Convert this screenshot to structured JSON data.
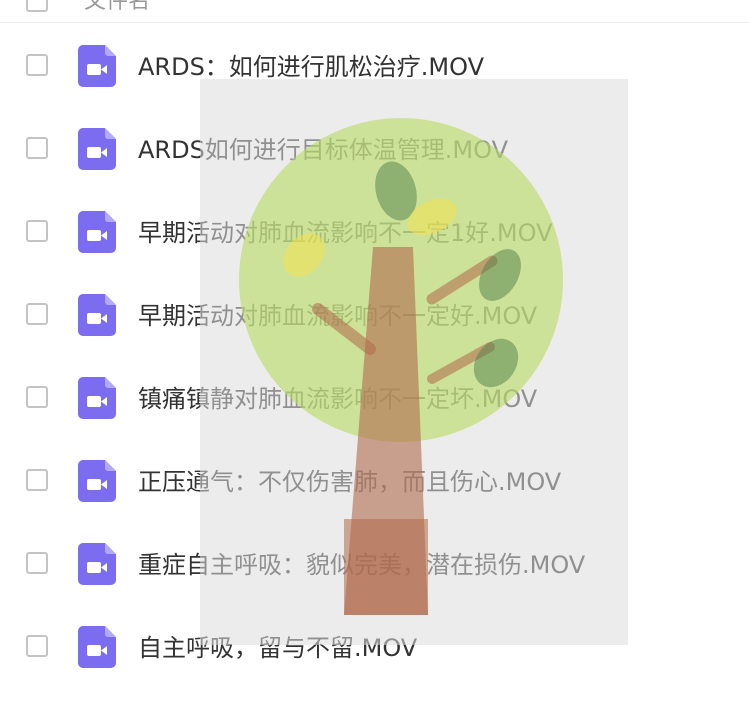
{
  "header": {
    "label": "文件名"
  },
  "files": [
    {
      "name": "ARDS：如何进行肌松治疗.MOV",
      "icon": "video-file-icon"
    },
    {
      "name": "ARDS如何进行目标体温管理.MOV",
      "icon": "video-file-icon"
    },
    {
      "name": "早期活动对肺血流影响不一定1好.MOV",
      "icon": "video-file-icon"
    },
    {
      "name": "早期活动对肺血流影响不一定好.MOV",
      "icon": "video-file-icon"
    },
    {
      "name": "镇痛镇静对肺血流影响不一定坏.MOV",
      "icon": "video-file-icon"
    },
    {
      "name": "正压通气：不仅伤害肺，而且伤心.MOV",
      "icon": "video-file-icon"
    },
    {
      "name": "重症自主呼吸：貌似完美，潜在损伤.MOV",
      "icon": "video-file-icon"
    },
    {
      "name": "自主呼吸，留与不留.MOV",
      "icon": "video-file-icon"
    }
  ],
  "colors": {
    "file_icon": "#7b6cf0",
    "tree_canopy": "#b9dc63",
    "tree_trunk": "#b06a4c",
    "leaf_dark": "#4f7d47",
    "leaf_yellow": "#f2e14f"
  }
}
